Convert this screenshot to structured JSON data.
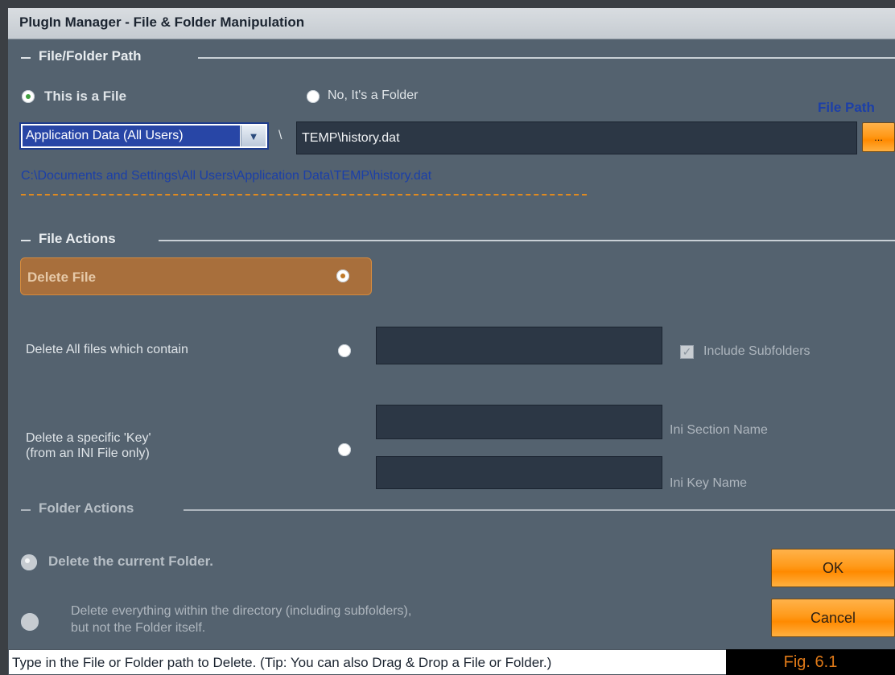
{
  "window": {
    "title": "PlugIn Manager - File & Folder Manipulation"
  },
  "file_folder_path": {
    "group_label": "File/Folder Path",
    "radio_file_label": "This is a File",
    "radio_folder_label": "No, It's a Folder",
    "file_path_label": "File Path",
    "location_select_value": "Application Data (All Users)",
    "separator": "\\",
    "path_value": "TEMP\\history.dat",
    "browse_label": "...",
    "full_path": "C:\\Documents and Settings\\All Users\\Application Data\\TEMP\\history.dat"
  },
  "file_actions": {
    "group_label": "File Actions",
    "delete_file_label": "Delete File",
    "delete_contain_label": "Delete All files which contain",
    "include_subfolders_label": "Include Subfolders",
    "delete_key_label_line1": "Delete a specific 'Key'",
    "delete_key_label_line2": "(from an INI File only)",
    "ini_section_label": "Ini Section Name",
    "ini_key_label": "Ini Key Name"
  },
  "folder_actions": {
    "group_label": "Folder Actions",
    "delete_folder_label": "Delete the current Folder.",
    "delete_contents_line1": "Delete everything within the directory (including subfolders),",
    "delete_contents_line2": "but not the Folder itself."
  },
  "buttons": {
    "ok": "OK",
    "cancel": "Cancel"
  },
  "status": {
    "text": "Type in the File or Folder path to Delete.  (Tip: You can also Drag & Drop a File or Folder.)",
    "figure": "Fig. 6.1"
  },
  "colors": {
    "accent_orange": "#ff9a1a",
    "panel": "#54626f",
    "field": "#2c3745",
    "selected_radio": "#40a040"
  }
}
